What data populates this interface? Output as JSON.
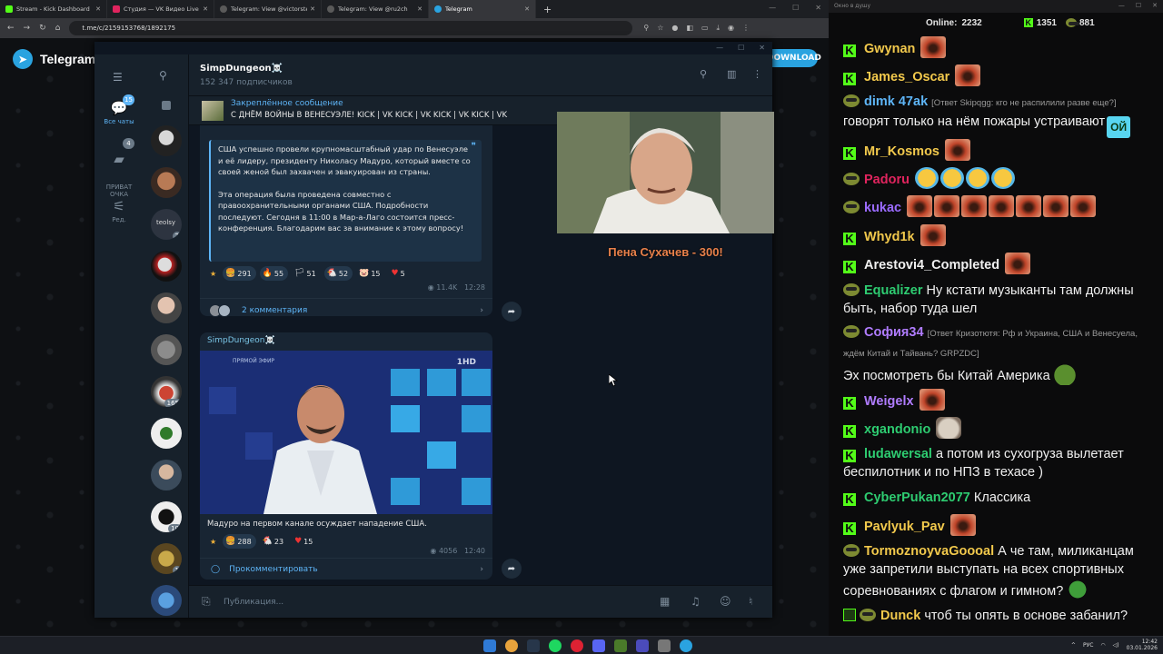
{
  "browser": {
    "tabs": [
      {
        "label": "Stream - Kick Dashboard",
        "color": "#53fc18"
      },
      {
        "label": "Студия — VK Видео Live",
        "color": "#e0245e"
      },
      {
        "label": "Telegram: View @victorstepan...",
        "color": "#5a5a5a"
      },
      {
        "label": "Telegram: View @ru2ch",
        "color": "#5a5a5a"
      },
      {
        "label": "Telegram",
        "color": "#2aa3e0"
      }
    ],
    "url": "t.me/c/2159153768/1892175"
  },
  "tgweb": {
    "logo": "Telegram",
    "download_btn": "DOWNLOAD"
  },
  "telegram": {
    "folders": [
      {
        "label": "Все чаты",
        "badge": "15",
        "icon": "chat-bubbles-icon"
      },
      {
        "label": "ПРИВАТ\nОЧКА",
        "badge": "4",
        "icon": "chat-bubble-icon"
      },
      {
        "label": "Ред.",
        "badge": "",
        "icon": "sliders-icon"
      }
    ],
    "chat_list_badges": {
      "teolsy": "2",
      "c165": "165",
      "c10": "10",
      "c1": "1"
    },
    "chat": {
      "title": "SimpDungeon☠️",
      "subscribers": "152 347 подписчиков",
      "pinned_title": "Закреплённое сообщение",
      "pinned_text": "С ДНЁМ ВОЙНЫ В ВЕНЕСУЭЛЕ! KICK | VK KICK | VK KICK | VK KICK | VK"
    },
    "msg1": {
      "p1": "США успешно провели крупномасштабный удар по Венесуэле и её лидеру, президенту Николасу Мадуро, который вместе со своей женой был захвачен и эвакуирован из страны.",
      "p2": "Эта операция была проведена совместно с правоохранительными органами США. Подробности последуют. Сегодня в 11:00 в Мар-а-Лаго состоится пресс-конференция. Благодарим вас за внимание к этому вопросу!",
      "reactions": [
        {
          "emoji": "🍔",
          "count": "291"
        },
        {
          "emoji": "🔥",
          "count": "55"
        },
        {
          "emoji": "🏳",
          "count": "51"
        },
        {
          "emoji": "🐔",
          "count": "52"
        },
        {
          "emoji": "🐷",
          "count": "15"
        },
        {
          "emoji": "♥",
          "count": "5"
        }
      ],
      "views": "11.4K",
      "time": "12:28",
      "comments": "2 комментария"
    },
    "msg2": {
      "author": "SimpDungeon☠️",
      "tv_badge": "ПРЯМОЙ ЭФИР",
      "channel_logo": "1HD",
      "caption": "Мадуро на первом канале осуждает нападение США.",
      "reactions": [
        {
          "emoji": "🍔",
          "count": "288"
        },
        {
          "emoji": "🐔",
          "count": "23"
        },
        {
          "emoji": "♥",
          "count": "15"
        }
      ],
      "views": "4056",
      "time": "12:40",
      "comment_btn": "Прокомментировать"
    },
    "composer_placeholder": "Публикация..."
  },
  "webcam": {
    "caption": "Пена Сухачев - 300!"
  },
  "stream_chat": {
    "window_title": "Окно в душу",
    "online_label": "Online:",
    "online_count": "2232",
    "stat_kick": "1351",
    "stat_vk": "881",
    "messages": [
      {
        "user": "Gwynan",
        "color": "#f2c94c",
        "text": "",
        "emotes": [
          "face"
        ],
        "src": "kick"
      },
      {
        "user": "James_Oscar",
        "color": "#f2c94c",
        "text": "",
        "emotes": [
          "face"
        ],
        "src": "kick"
      },
      {
        "user": "dimk 47ak",
        "color": "#5eb5f7",
        "reply": "[Ответ Skipqgg: кго не распилили разве еще?]",
        "text": "говорят только на нём пожары устраивают",
        "emotes": [
          "oy"
        ],
        "src": "vk"
      },
      {
        "user": "Mr_Kosmos",
        "color": "#f2c94c",
        "text": "",
        "emotes": [
          "face"
        ],
        "src": "kick"
      },
      {
        "user": "Padoru",
        "color": "#e0245e",
        "text": "",
        "emotes": [
          "laugh",
          "laugh",
          "laugh",
          "laugh"
        ],
        "src": "vk"
      },
      {
        "user": "kukac",
        "color": "#9b6bff",
        "text": "",
        "emotes": [
          "face",
          "face",
          "face",
          "face",
          "face",
          "face",
          "face"
        ],
        "src": "vk"
      },
      {
        "user": "Whyd1k",
        "color": "#f2c94c",
        "text": "",
        "emotes": [
          "face"
        ],
        "src": "kick"
      },
      {
        "user": "Arestovi4_Completed",
        "color": "#f0f0f0",
        "text": "",
        "emotes": [
          "face"
        ],
        "src": "kick"
      },
      {
        "user": "Equalizer",
        "color": "#2ecc71",
        "text": "Ну кстати музыканты там должны быть, набор туда шел",
        "emotes": [],
        "src": "vk"
      },
      {
        "user": "София34",
        "color": "#b07cff",
        "reply": "[Ответ Кризотютя: Рф и Украина, США и Венесуела, ждём Китай и Тайвань? GRPZDC]",
        "text": "Эх посмотреть бы Китай Америка",
        "emotes": [
          "pepeface"
        ],
        "src": "vk"
      },
      {
        "user": "Weigelx",
        "color": "#b07cff",
        "text": "",
        "emotes": [
          "face"
        ],
        "src": "kick"
      },
      {
        "user": "xgandonio",
        "color": "#2ecc71",
        "text": "",
        "emotes": [
          "cat"
        ],
        "src": "kick"
      },
      {
        "user": "ludawersal",
        "color": "#2ecc71",
        "text": "а потом из сухогруза вылетает беспилотник и по НПЗ в техасе )",
        "emotes": [],
        "src": "kick"
      },
      {
        "user": "CyberPukan2077",
        "color": "#2ecc71",
        "text": "Классика",
        "emotes": [],
        "src": "kick"
      },
      {
        "user": "Pavlyuk_Pav",
        "color": "#f2c94c",
        "text": "",
        "emotes": [
          "face"
        ],
        "src": "kick"
      },
      {
        "user": "TormoznoyvaGoooal",
        "color": "#f2c94c",
        "text": "А че там, миликанцам уже запретили выступать на всех спортивных соревнованиях с флагом и гимном?",
        "emotes": [
          "plant"
        ],
        "src": "vk"
      },
      {
        "user": "Dunck",
        "color": "#f2c94c",
        "text": "чтоб ты опять в основе забанил?",
        "emotes": [],
        "src": "vkmod"
      }
    ]
  },
  "taskbar": {
    "lang": "РУС",
    "time": "12:42",
    "date": "03.01.2026"
  }
}
